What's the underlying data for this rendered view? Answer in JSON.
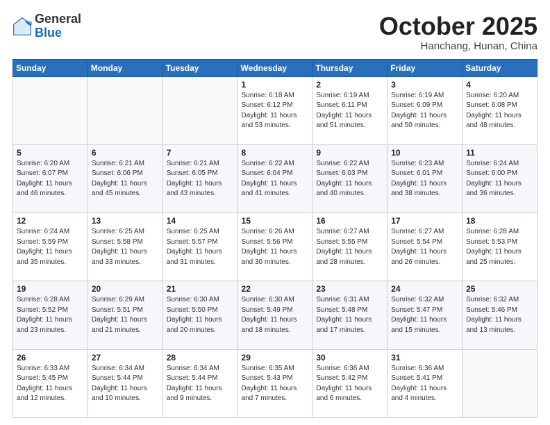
{
  "header": {
    "logo_general": "General",
    "logo_blue": "Blue",
    "month": "October 2025",
    "location": "Hanchang, Hunan, China"
  },
  "weekdays": [
    "Sunday",
    "Monday",
    "Tuesday",
    "Wednesday",
    "Thursday",
    "Friday",
    "Saturday"
  ],
  "weeks": [
    [
      {
        "day": "",
        "info": ""
      },
      {
        "day": "",
        "info": ""
      },
      {
        "day": "",
        "info": ""
      },
      {
        "day": "1",
        "info": "Sunrise: 6:18 AM\nSunset: 6:12 PM\nDaylight: 11 hours\nand 53 minutes."
      },
      {
        "day": "2",
        "info": "Sunrise: 6:19 AM\nSunset: 6:11 PM\nDaylight: 11 hours\nand 51 minutes."
      },
      {
        "day": "3",
        "info": "Sunrise: 6:19 AM\nSunset: 6:09 PM\nDaylight: 11 hours\nand 50 minutes."
      },
      {
        "day": "4",
        "info": "Sunrise: 6:20 AM\nSunset: 6:08 PM\nDaylight: 11 hours\nand 48 minutes."
      }
    ],
    [
      {
        "day": "5",
        "info": "Sunrise: 6:20 AM\nSunset: 6:07 PM\nDaylight: 11 hours\nand 46 minutes."
      },
      {
        "day": "6",
        "info": "Sunrise: 6:21 AM\nSunset: 6:06 PM\nDaylight: 11 hours\nand 45 minutes."
      },
      {
        "day": "7",
        "info": "Sunrise: 6:21 AM\nSunset: 6:05 PM\nDaylight: 11 hours\nand 43 minutes."
      },
      {
        "day": "8",
        "info": "Sunrise: 6:22 AM\nSunset: 6:04 PM\nDaylight: 11 hours\nand 41 minutes."
      },
      {
        "day": "9",
        "info": "Sunrise: 6:22 AM\nSunset: 6:03 PM\nDaylight: 11 hours\nand 40 minutes."
      },
      {
        "day": "10",
        "info": "Sunrise: 6:23 AM\nSunset: 6:01 PM\nDaylight: 11 hours\nand 38 minutes."
      },
      {
        "day": "11",
        "info": "Sunrise: 6:24 AM\nSunset: 6:00 PM\nDaylight: 11 hours\nand 36 minutes."
      }
    ],
    [
      {
        "day": "12",
        "info": "Sunrise: 6:24 AM\nSunset: 5:59 PM\nDaylight: 11 hours\nand 35 minutes."
      },
      {
        "day": "13",
        "info": "Sunrise: 6:25 AM\nSunset: 5:58 PM\nDaylight: 11 hours\nand 33 minutes."
      },
      {
        "day": "14",
        "info": "Sunrise: 6:25 AM\nSunset: 5:57 PM\nDaylight: 11 hours\nand 31 minutes."
      },
      {
        "day": "15",
        "info": "Sunrise: 6:26 AM\nSunset: 5:56 PM\nDaylight: 11 hours\nand 30 minutes."
      },
      {
        "day": "16",
        "info": "Sunrise: 6:27 AM\nSunset: 5:55 PM\nDaylight: 11 hours\nand 28 minutes."
      },
      {
        "day": "17",
        "info": "Sunrise: 6:27 AM\nSunset: 5:54 PM\nDaylight: 11 hours\nand 26 minutes."
      },
      {
        "day": "18",
        "info": "Sunrise: 6:28 AM\nSunset: 5:53 PM\nDaylight: 11 hours\nand 25 minutes."
      }
    ],
    [
      {
        "day": "19",
        "info": "Sunrise: 6:28 AM\nSunset: 5:52 PM\nDaylight: 11 hours\nand 23 minutes."
      },
      {
        "day": "20",
        "info": "Sunrise: 6:29 AM\nSunset: 5:51 PM\nDaylight: 11 hours\nand 21 minutes."
      },
      {
        "day": "21",
        "info": "Sunrise: 6:30 AM\nSunset: 5:50 PM\nDaylight: 11 hours\nand 20 minutes."
      },
      {
        "day": "22",
        "info": "Sunrise: 6:30 AM\nSunset: 5:49 PM\nDaylight: 11 hours\nand 18 minutes."
      },
      {
        "day": "23",
        "info": "Sunrise: 6:31 AM\nSunset: 5:48 PM\nDaylight: 11 hours\nand 17 minutes."
      },
      {
        "day": "24",
        "info": "Sunrise: 6:32 AM\nSunset: 5:47 PM\nDaylight: 11 hours\nand 15 minutes."
      },
      {
        "day": "25",
        "info": "Sunrise: 6:32 AM\nSunset: 5:46 PM\nDaylight: 11 hours\nand 13 minutes."
      }
    ],
    [
      {
        "day": "26",
        "info": "Sunrise: 6:33 AM\nSunset: 5:45 PM\nDaylight: 11 hours\nand 12 minutes."
      },
      {
        "day": "27",
        "info": "Sunrise: 6:34 AM\nSunset: 5:44 PM\nDaylight: 11 hours\nand 10 minutes."
      },
      {
        "day": "28",
        "info": "Sunrise: 6:34 AM\nSunset: 5:44 PM\nDaylight: 11 hours\nand 9 minutes."
      },
      {
        "day": "29",
        "info": "Sunrise: 6:35 AM\nSunset: 5:43 PM\nDaylight: 11 hours\nand 7 minutes."
      },
      {
        "day": "30",
        "info": "Sunrise: 6:36 AM\nSunset: 5:42 PM\nDaylight: 11 hours\nand 6 minutes."
      },
      {
        "day": "31",
        "info": "Sunrise: 6:36 AM\nSunset: 5:41 PM\nDaylight: 11 hours\nand 4 minutes."
      },
      {
        "day": "",
        "info": ""
      }
    ]
  ]
}
